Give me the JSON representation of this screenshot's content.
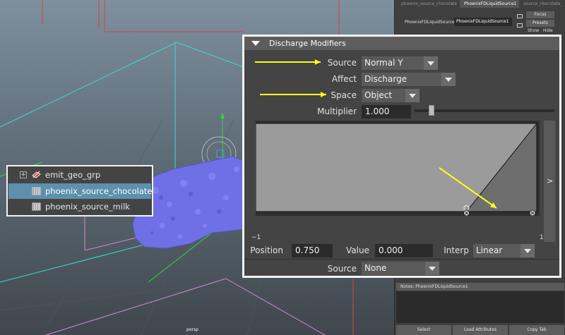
{
  "viewport": {
    "camera_label": "persp",
    "outliner": {
      "items": [
        {
          "label": "emit_geo_grp",
          "expandable": true,
          "selected": false
        },
        {
          "label": "phoenix_source_chocolate",
          "expandable": false,
          "selected": true
        },
        {
          "label": "phoenix_source_milk",
          "expandable": false,
          "selected": false
        }
      ]
    }
  },
  "attribute_editor": {
    "tabs": [
      "phoenix_source_chocolate",
      "PhoenixFDLiquidSource1",
      "source_chocolate_"
    ],
    "active_tab": 1,
    "node_label": "PhoenixFDLiquidSource:",
    "node_value": "PhoenixFDLiquidSource1",
    "focus_label": "Focus",
    "presets_label": "Presets",
    "show_label": "Show",
    "hide_label": "Hide",
    "notes_label": "Notes:  PhoenixFDLiquidSource1",
    "buttons": {
      "select": "Select",
      "load_attributes": "Load Attributes",
      "copy_tab": "Copy Tab"
    }
  },
  "discharge_modifiers": {
    "title": "Discharge Modifiers",
    "source_label": "Source",
    "source_value": "Normal Y",
    "affect_label": "Affect",
    "affect_value": "Discharge",
    "space_label": "Space",
    "space_value": "Object",
    "multiplier_label": "Multiplier",
    "multiplier_value": "1.000",
    "multiplier_slider_fraction": 0.12,
    "ramp": {
      "x_min_label": "−1",
      "x_max_label": "1",
      "points": [
        {
          "position": 0.75,
          "value": 0.0
        },
        {
          "position": 1.0,
          "value": 1.0
        }
      ]
    },
    "expand_button": ">",
    "position_label": "Position",
    "position_value": "0.750",
    "value_label": "Value",
    "value_value": "0.000",
    "interp_label": "Interp",
    "interp_value": "Linear",
    "bottom_source_label": "Source",
    "bottom_source_value": "None"
  },
  "annotation_color": "#ffff1a"
}
